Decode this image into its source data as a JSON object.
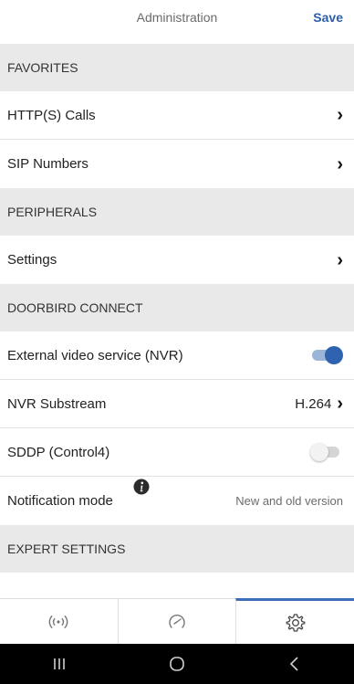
{
  "header": {
    "title": "Administration",
    "save_label": "Save"
  },
  "sections": {
    "favorites": "FAVORITES",
    "peripherals": "PERIPHERALS",
    "doorbird_connect": "DOORBIRD CONNECT",
    "expert_settings": "EXPERT SETTINGS"
  },
  "rows": {
    "http_calls": "HTTP(S) Calls",
    "sip_numbers": "SIP Numbers",
    "settings": "Settings",
    "external_video": "External video service (NVR)",
    "nvr_substream": "NVR Substream",
    "nvr_substream_value": "H.264",
    "sddp": "SDDP (Control4)",
    "notification_mode": "Notification mode",
    "notification_mode_value": "New and old version"
  },
  "toggles": {
    "external_video_on": true,
    "sddp_on": false
  },
  "tabs": [
    {
      "icon": "broadcast-icon"
    },
    {
      "icon": "gauge-icon"
    },
    {
      "icon": "gear-icon",
      "active": true
    }
  ],
  "system_nav": [
    "recent-apps-icon",
    "home-icon",
    "back-icon"
  ],
  "colors": {
    "accent": "#2f63b0",
    "section_bg": "#e9e9e9",
    "nav_bg": "#000000"
  }
}
